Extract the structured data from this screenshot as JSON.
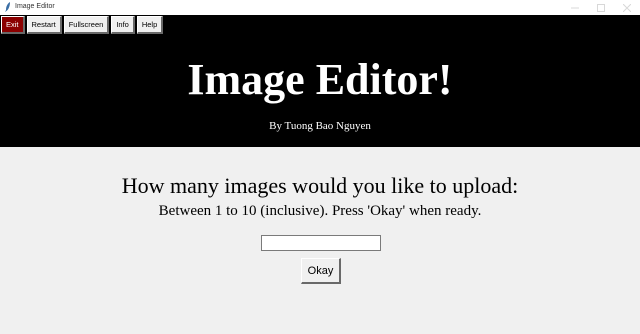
{
  "window": {
    "title": "Image Editor"
  },
  "toolbar": {
    "exit_label": "Exit",
    "restart_label": "Restart",
    "fullscreen_label": "Fullscreen",
    "info_label": "Info",
    "help_label": "Help"
  },
  "header": {
    "headline": "Image Editor!",
    "byline": "By Tuong Bao Nguyen"
  },
  "main": {
    "question": "How many images would you like to upload:",
    "hint": "Between 1 to 10 (inclusive). Press 'Okay' when ready.",
    "count_input_value": "",
    "okay_label": "Okay"
  },
  "colors": {
    "header_bg": "#000000",
    "window_bg": "#f0f0f0",
    "exit_bg": "#8b0000"
  },
  "icons": {
    "app": "feather-icon",
    "minimize": "minimize-icon",
    "maximize": "maximize-icon",
    "close": "close-icon"
  }
}
